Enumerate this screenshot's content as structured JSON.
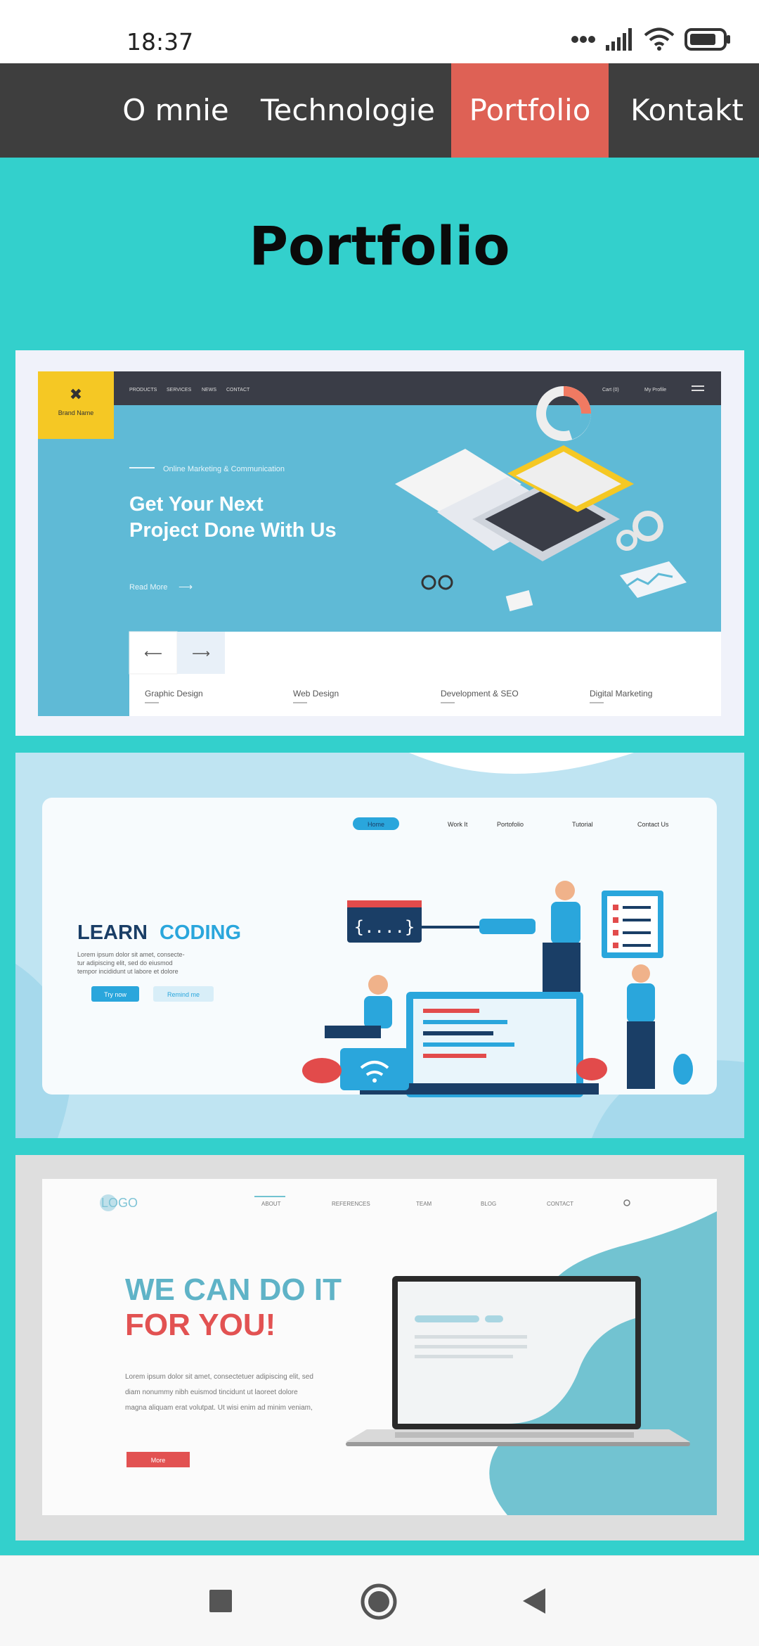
{
  "status_bar": {
    "time": "18:37",
    "icons": [
      "more-dots-icon",
      "signal-icon",
      "wifi-icon",
      "battery-icon"
    ]
  },
  "nav": {
    "items": [
      {
        "label": "O mnie"
      },
      {
        "label": "Technologie"
      },
      {
        "label": "Portfolio",
        "active": true
      },
      {
        "label": "Kontakt"
      }
    ],
    "active_color": "#de6155",
    "background": "#3e3e3e"
  },
  "page": {
    "title": "Portfolio",
    "background": "#33d0cc"
  },
  "portfolio": {
    "card1": {
      "brand": "Brand Name",
      "menu": [
        "PRODUCTS",
        "SERVICES",
        "NEWS",
        "CONTACT"
      ],
      "cart": "Cart (0)",
      "profile": "My Profile",
      "kicker": "Online Marketing & Communication",
      "headline_1": "Get Your Next",
      "headline_2": "Project Done With Us",
      "read_more": "Read More",
      "categories": [
        "Graphic Design",
        "Web Design",
        "Development & SEO",
        "Digital Marketing"
      ]
    },
    "card2": {
      "menu": [
        "Home",
        "Work It",
        "Portofolio",
        "Tutorial",
        "Contact Us"
      ],
      "headline_a": "LEARN",
      "headline_b": "CODING",
      "body_1": "Lorem ipsum dolor sit amet, consecte-",
      "body_2": "tur adipiscing elit, sed do eiusmod",
      "body_3": "tempor incididunt ut labore et dolore",
      "btn_primary": "Try now",
      "btn_secondary": "Remind me",
      "code": "{....}"
    },
    "card3": {
      "logo": "LOGO",
      "menu": [
        "ABOUT",
        "REFERENCES",
        "TEAM",
        "BLOG",
        "CONTACT"
      ],
      "headline_1": "WE CAN DO IT",
      "headline_2": "FOR YOU!",
      "body_1": "Lorem ipsum dolor sit amet, consectetuer adipiscing elit, sed",
      "body_2": "diam nonummy nibh euismod tincidunt ut laoreet dolore",
      "body_3": "magna aliquam erat volutpat. Ut wisi enim ad minim veniam,",
      "button": "More"
    }
  },
  "system_nav": [
    "recents-square-icon",
    "home-circle-icon",
    "back-triangle-icon"
  ]
}
